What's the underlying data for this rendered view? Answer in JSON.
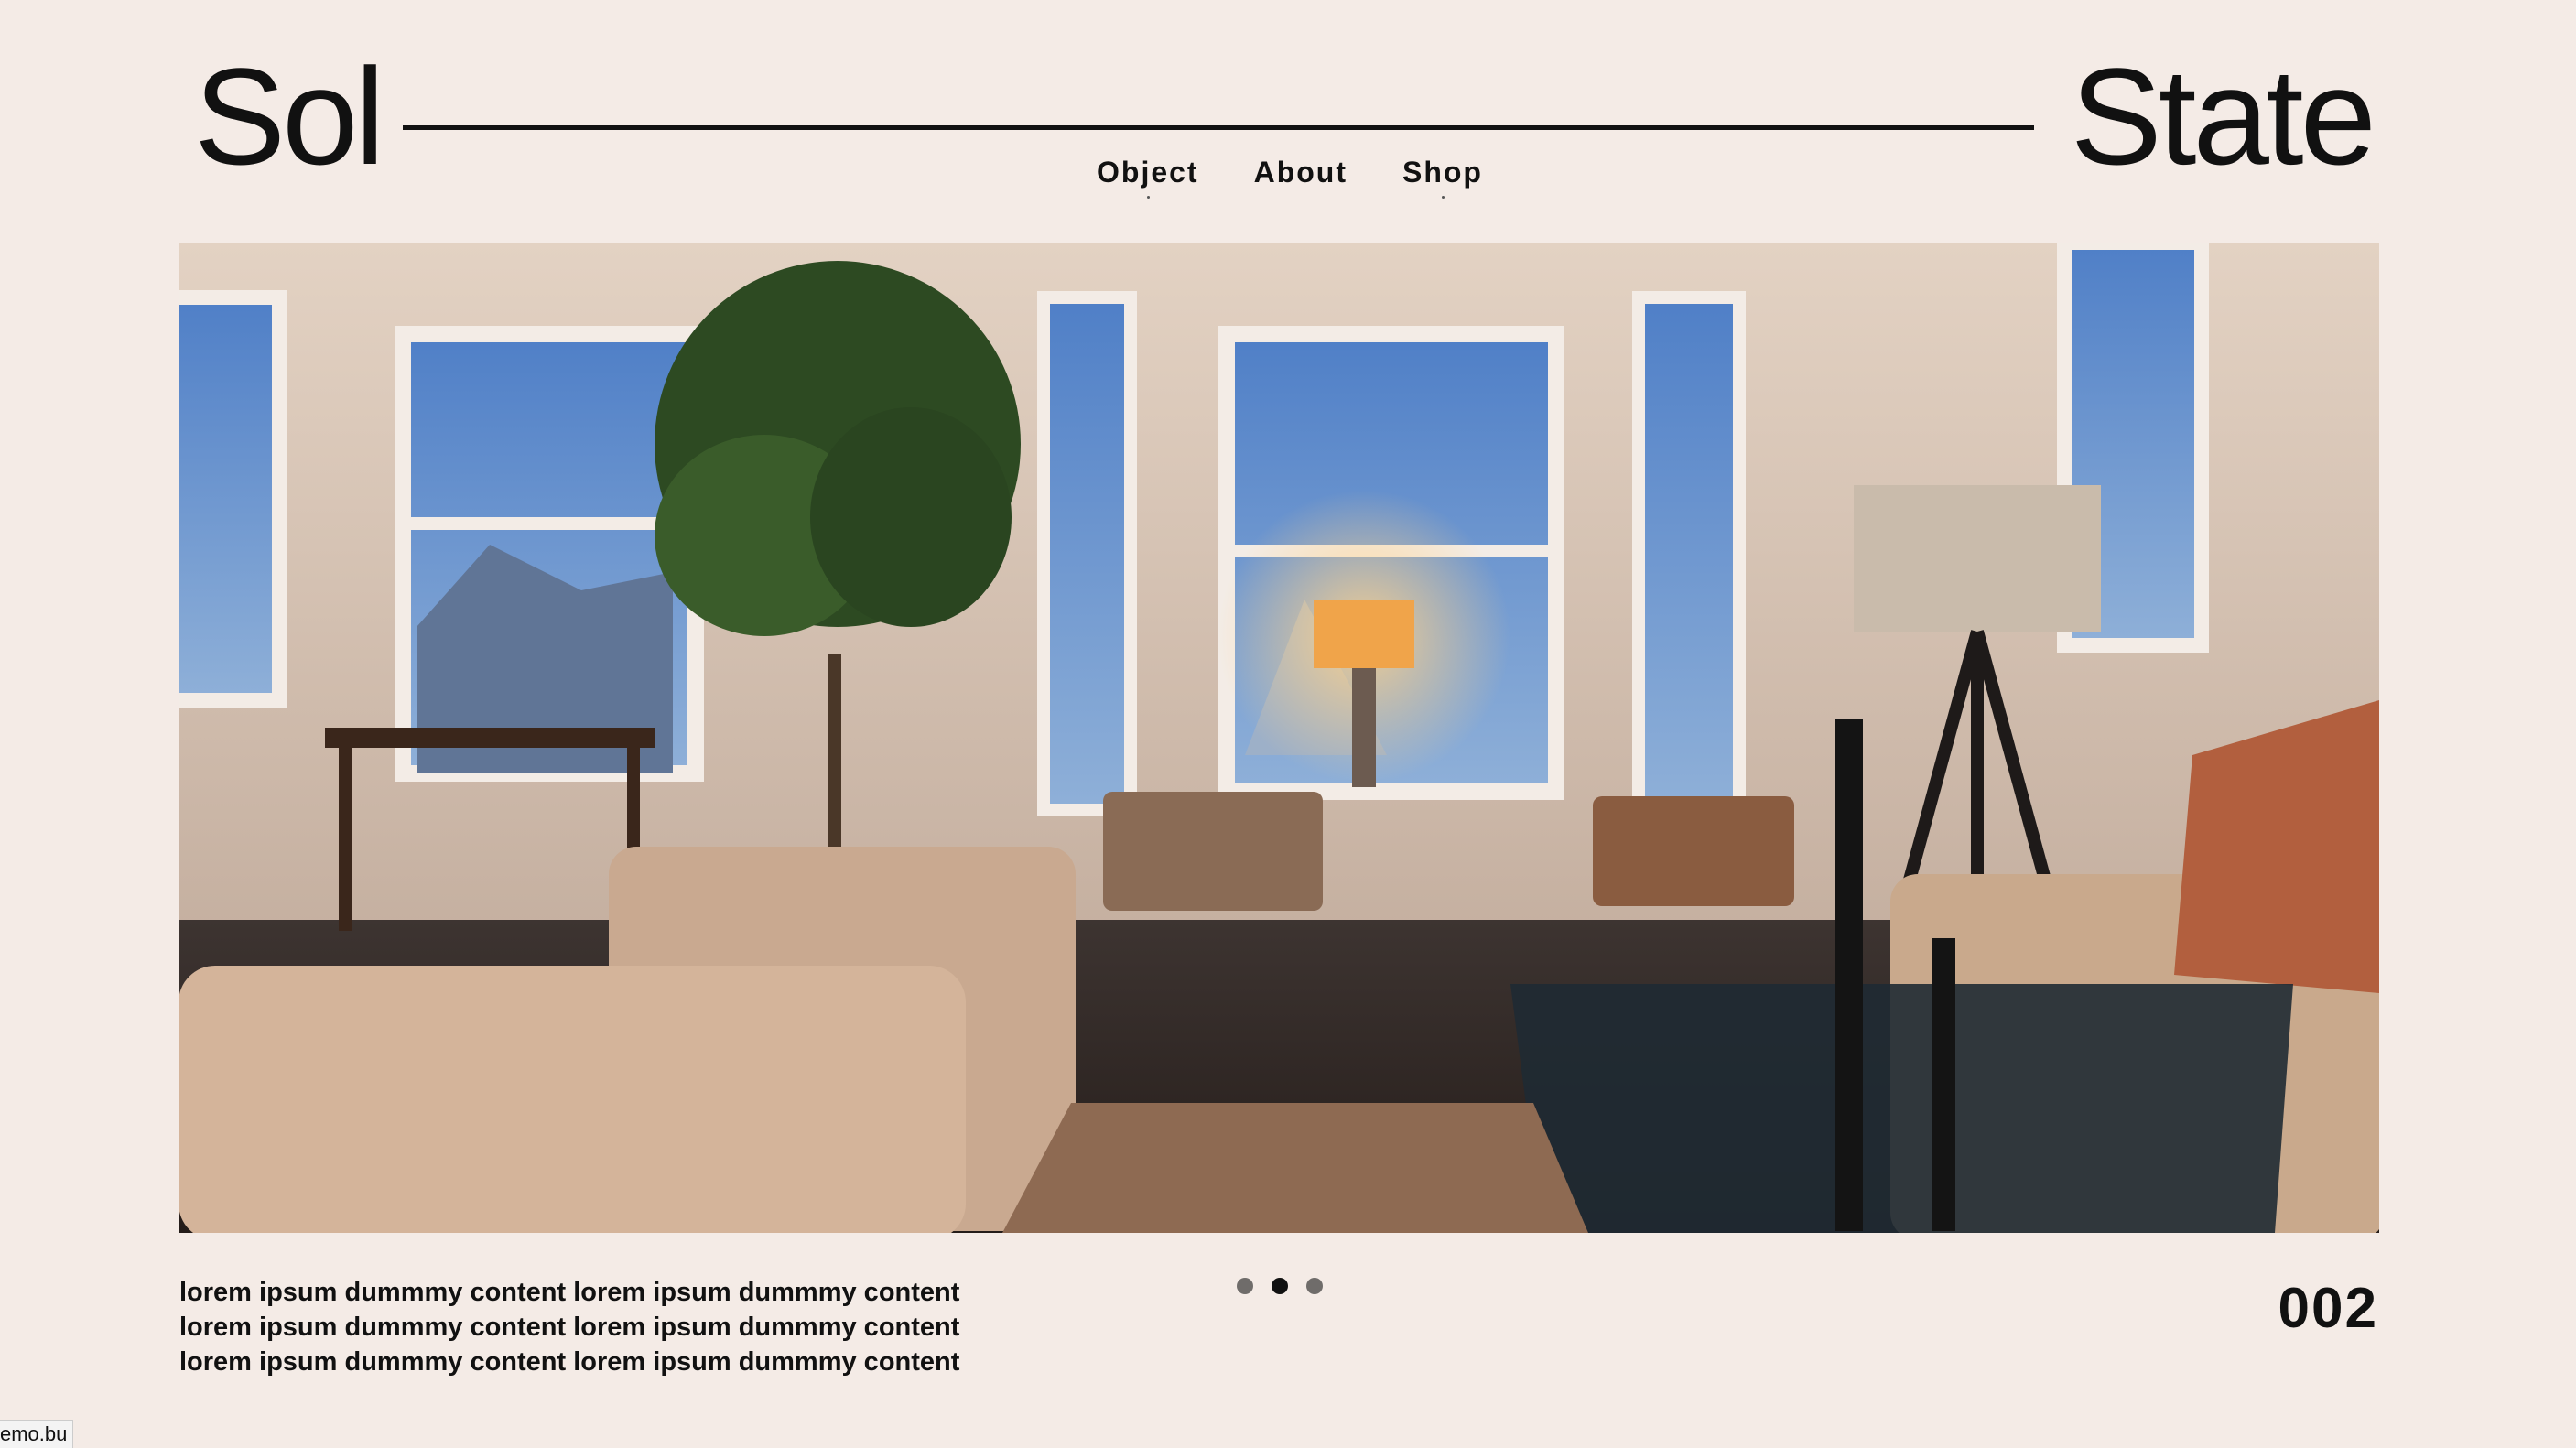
{
  "brand": {
    "left": "Sol",
    "right": "State"
  },
  "nav": [
    {
      "label": "Object"
    },
    {
      "label": "About"
    },
    {
      "label": "Shop"
    }
  ],
  "hero": {
    "alt": "Living room interior with bay windows, lounge chairs, floor lamp and fiddle leaf fig tree"
  },
  "caption": "lorem ipsum dummmy content lorem ipsum dummmy content lorem ipsum dummmy content lorem ipsum dummmy content lorem ipsum dummmy content lorem ipsum dummmy content",
  "slider": {
    "total": 3,
    "active_index": 1
  },
  "counter": "002",
  "status_bar": "emo.bu",
  "colors": {
    "background": "#f4ebe6",
    "text": "#111111",
    "dot_inactive": "#6f6c6a"
  }
}
